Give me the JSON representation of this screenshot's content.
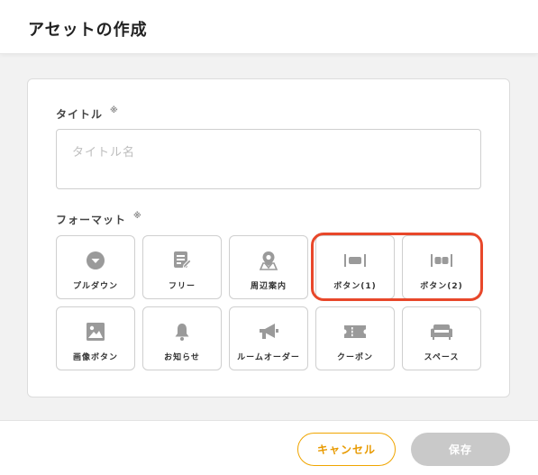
{
  "header": {
    "title": "アセットの作成"
  },
  "form": {
    "title_label": "タイトル",
    "required_mark": "※",
    "title_placeholder": "タイトル名",
    "format_label": "フォーマット"
  },
  "formats": [
    {
      "label": "プルダウン",
      "icon": "dropdown-circle-icon"
    },
    {
      "label": "フリー",
      "icon": "free-edit-icon"
    },
    {
      "label": "周辺案内",
      "icon": "map-pin-icon"
    },
    {
      "label": "ボタン(1)",
      "icon": "single-button-icon"
    },
    {
      "label": "ボタン(2)",
      "icon": "double-button-icon"
    },
    {
      "label": "画像ボタン",
      "icon": "image-icon"
    },
    {
      "label": "お知らせ",
      "icon": "bell-icon"
    },
    {
      "label": "ルームオーダー",
      "icon": "megaphone-icon"
    },
    {
      "label": "クーポン",
      "icon": "ticket-icon"
    },
    {
      "label": "スペース",
      "icon": "sofa-icon"
    }
  ],
  "footer": {
    "cancel_label": "キャンセル",
    "save_label": "保存"
  },
  "colors": {
    "accent": "#e89a00",
    "highlight": "#e8472a",
    "icon": "#9a9a9a",
    "disabled": "#c9c9c9"
  }
}
